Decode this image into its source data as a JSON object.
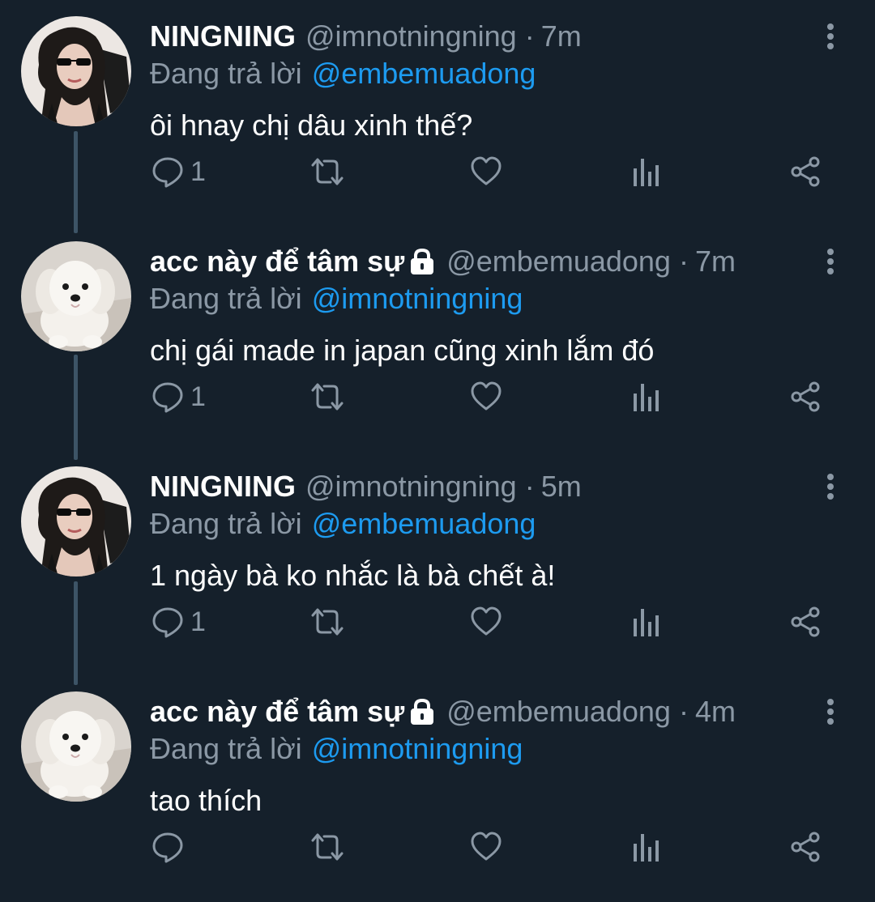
{
  "colors": {
    "background": "#15202b",
    "secondary_text": "#8b98a5",
    "link": "#1d9bf0",
    "thread_line": "#3d5466"
  },
  "tweets": [
    {
      "display_name": "NINGNING",
      "locked": false,
      "handle": "@imnotningning",
      "separator": "·",
      "time": "7m",
      "reply_prefix": "Đang trả lời",
      "reply_to": "@embemuadong",
      "text": "ôi hnay chị dâu xinh thế?",
      "reply_count": "1",
      "avatar": "girl-sunglasses-avatar"
    },
    {
      "display_name": "acc này để tâm sự",
      "locked": true,
      "handle": "@embemuadong",
      "separator": "·",
      "time": "7m",
      "reply_prefix": "Đang trả lời",
      "reply_to": "@imnotningning",
      "text": "chị gái made in japan cũng xinh lắm đó",
      "reply_count": "1",
      "avatar": "white-puppy-avatar"
    },
    {
      "display_name": "NINGNING",
      "locked": false,
      "handle": "@imnotningning",
      "separator": "·",
      "time": "5m",
      "reply_prefix": "Đang trả lời",
      "reply_to": "@embemuadong",
      "text": "1 ngày bà ko nhắc là bà chết à!",
      "reply_count": "1",
      "avatar": "girl-sunglasses-avatar"
    },
    {
      "display_name": "acc này để tâm sự",
      "locked": true,
      "handle": "@embemuadong",
      "separator": "·",
      "time": "4m",
      "reply_prefix": "Đang trả lời",
      "reply_to": "@imnotningning",
      "text": "tao thích",
      "reply_count": "",
      "avatar": "white-puppy-avatar"
    }
  ],
  "action_icons": [
    "reply-icon",
    "retweet-icon",
    "like-icon",
    "analytics-icon",
    "share-icon"
  ]
}
